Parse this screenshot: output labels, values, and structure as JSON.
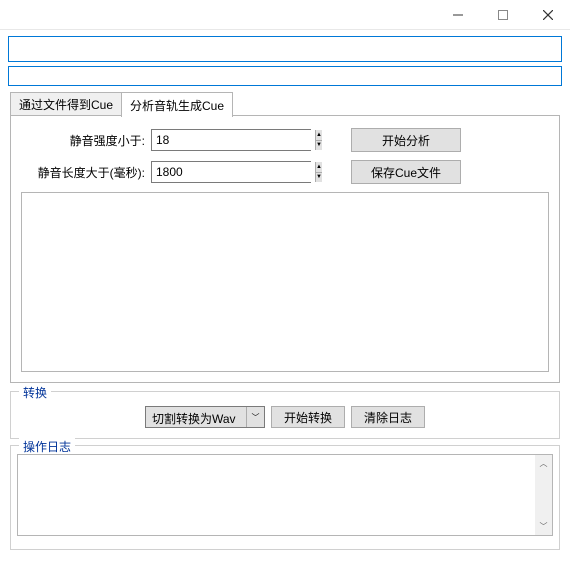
{
  "tabs": {
    "file": "通过文件得到Cue",
    "analyze": "分析音轨生成Cue"
  },
  "form": {
    "intensity_label": "静音强度小于:",
    "intensity_value": "18",
    "length_label": "静音长度大于(毫秒):",
    "length_value": "1800",
    "start_analysis": "开始分析",
    "save_cue": "保存Cue文件"
  },
  "convert": {
    "group_label": "转换",
    "combo_value": "切割转换为Wav",
    "start_convert": "开始转换",
    "clear_log": "清除日志"
  },
  "log": {
    "group_label": "操作日志"
  }
}
